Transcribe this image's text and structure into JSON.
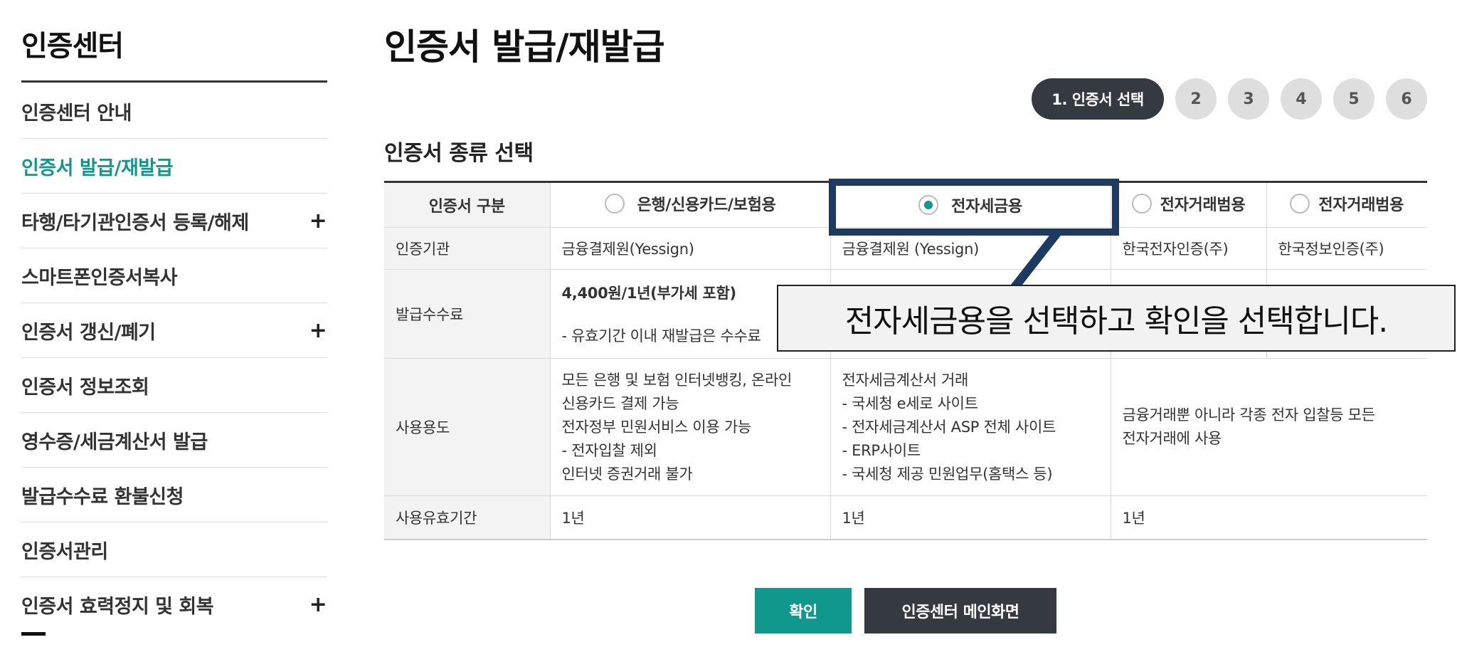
{
  "sidebar": {
    "title": "인증센터",
    "items": [
      {
        "label": "인증센터 안내",
        "expand": ""
      },
      {
        "label": "인증서 발급/재발급",
        "expand": ""
      },
      {
        "label": "타행/타기관인증서 등록/해제",
        "expand": "+"
      },
      {
        "label": "스마트폰인증서복사",
        "expand": ""
      },
      {
        "label": "인증서 갱신/폐기",
        "expand": "+"
      },
      {
        "label": "인증서 정보조회",
        "expand": ""
      },
      {
        "label": "영수증/세금계산서 발급",
        "expand": ""
      },
      {
        "label": "발급수수료 환불신청",
        "expand": ""
      },
      {
        "label": "인증서관리",
        "expand": ""
      },
      {
        "label": "인증서 효력정지 및 회복",
        "expand": "+"
      }
    ],
    "active_index": 1
  },
  "main": {
    "title": "인증서 발급/재발급",
    "steps": [
      "1. 인증서 선택",
      "2",
      "3",
      "4",
      "5",
      "6"
    ],
    "section_title": "인증서 종류 선택"
  },
  "table": {
    "header_label": "인증서 구분",
    "columns": [
      "은행/신용카드/보험용",
      "전자세금용",
      "전자거래범용",
      "전자거래범용"
    ],
    "selected_column": 1,
    "rows": {
      "org": {
        "label": "인증기관",
        "values": [
          "금융결제원(Yessign)",
          "금융결제원 (Yessign)",
          "한국전자인증(주)",
          "한국정보인증(주)"
        ]
      },
      "fee": {
        "label": "발급수수료",
        "col1_line1": "4,400원/1년(부가세 포함)",
        "col1_line2": "- 유효기간 이내 재발급은 수수료"
      },
      "use": {
        "label": "사용용도",
        "col1": [
          "모든 은행 및 보험 인터넷뱅킹, 온라인",
          "신용카드 결제 가능",
          "전자정부 민원서비스 이용 가능",
          "- 전자입찰 제외",
          "인터넷 증권거래 불가"
        ],
        "col2": [
          "전자세금계산서 거래",
          "- 국세청 e세로 사이트",
          "- 전자세금계산서 ASP 전체 사이트",
          "- ERP사이트",
          "- 국세청 제공 민원업무(홈택스 등)"
        ],
        "col3": [
          "금융거래뿐 아니라 각종 전자 입찰등 모든",
          "전자거래에 사용"
        ]
      },
      "valid": {
        "label": "사용유효기간",
        "values": [
          "1년",
          "1년",
          "1년"
        ]
      }
    }
  },
  "callout": {
    "text": "전자세금용을 선택하고 확인을 선택합니다."
  },
  "buttons": {
    "confirm": "확인",
    "main": "인증센터 메인화면"
  },
  "colors": {
    "accent": "#10988c",
    "dark": "#343a40",
    "callout_border": "#1d3a63"
  }
}
